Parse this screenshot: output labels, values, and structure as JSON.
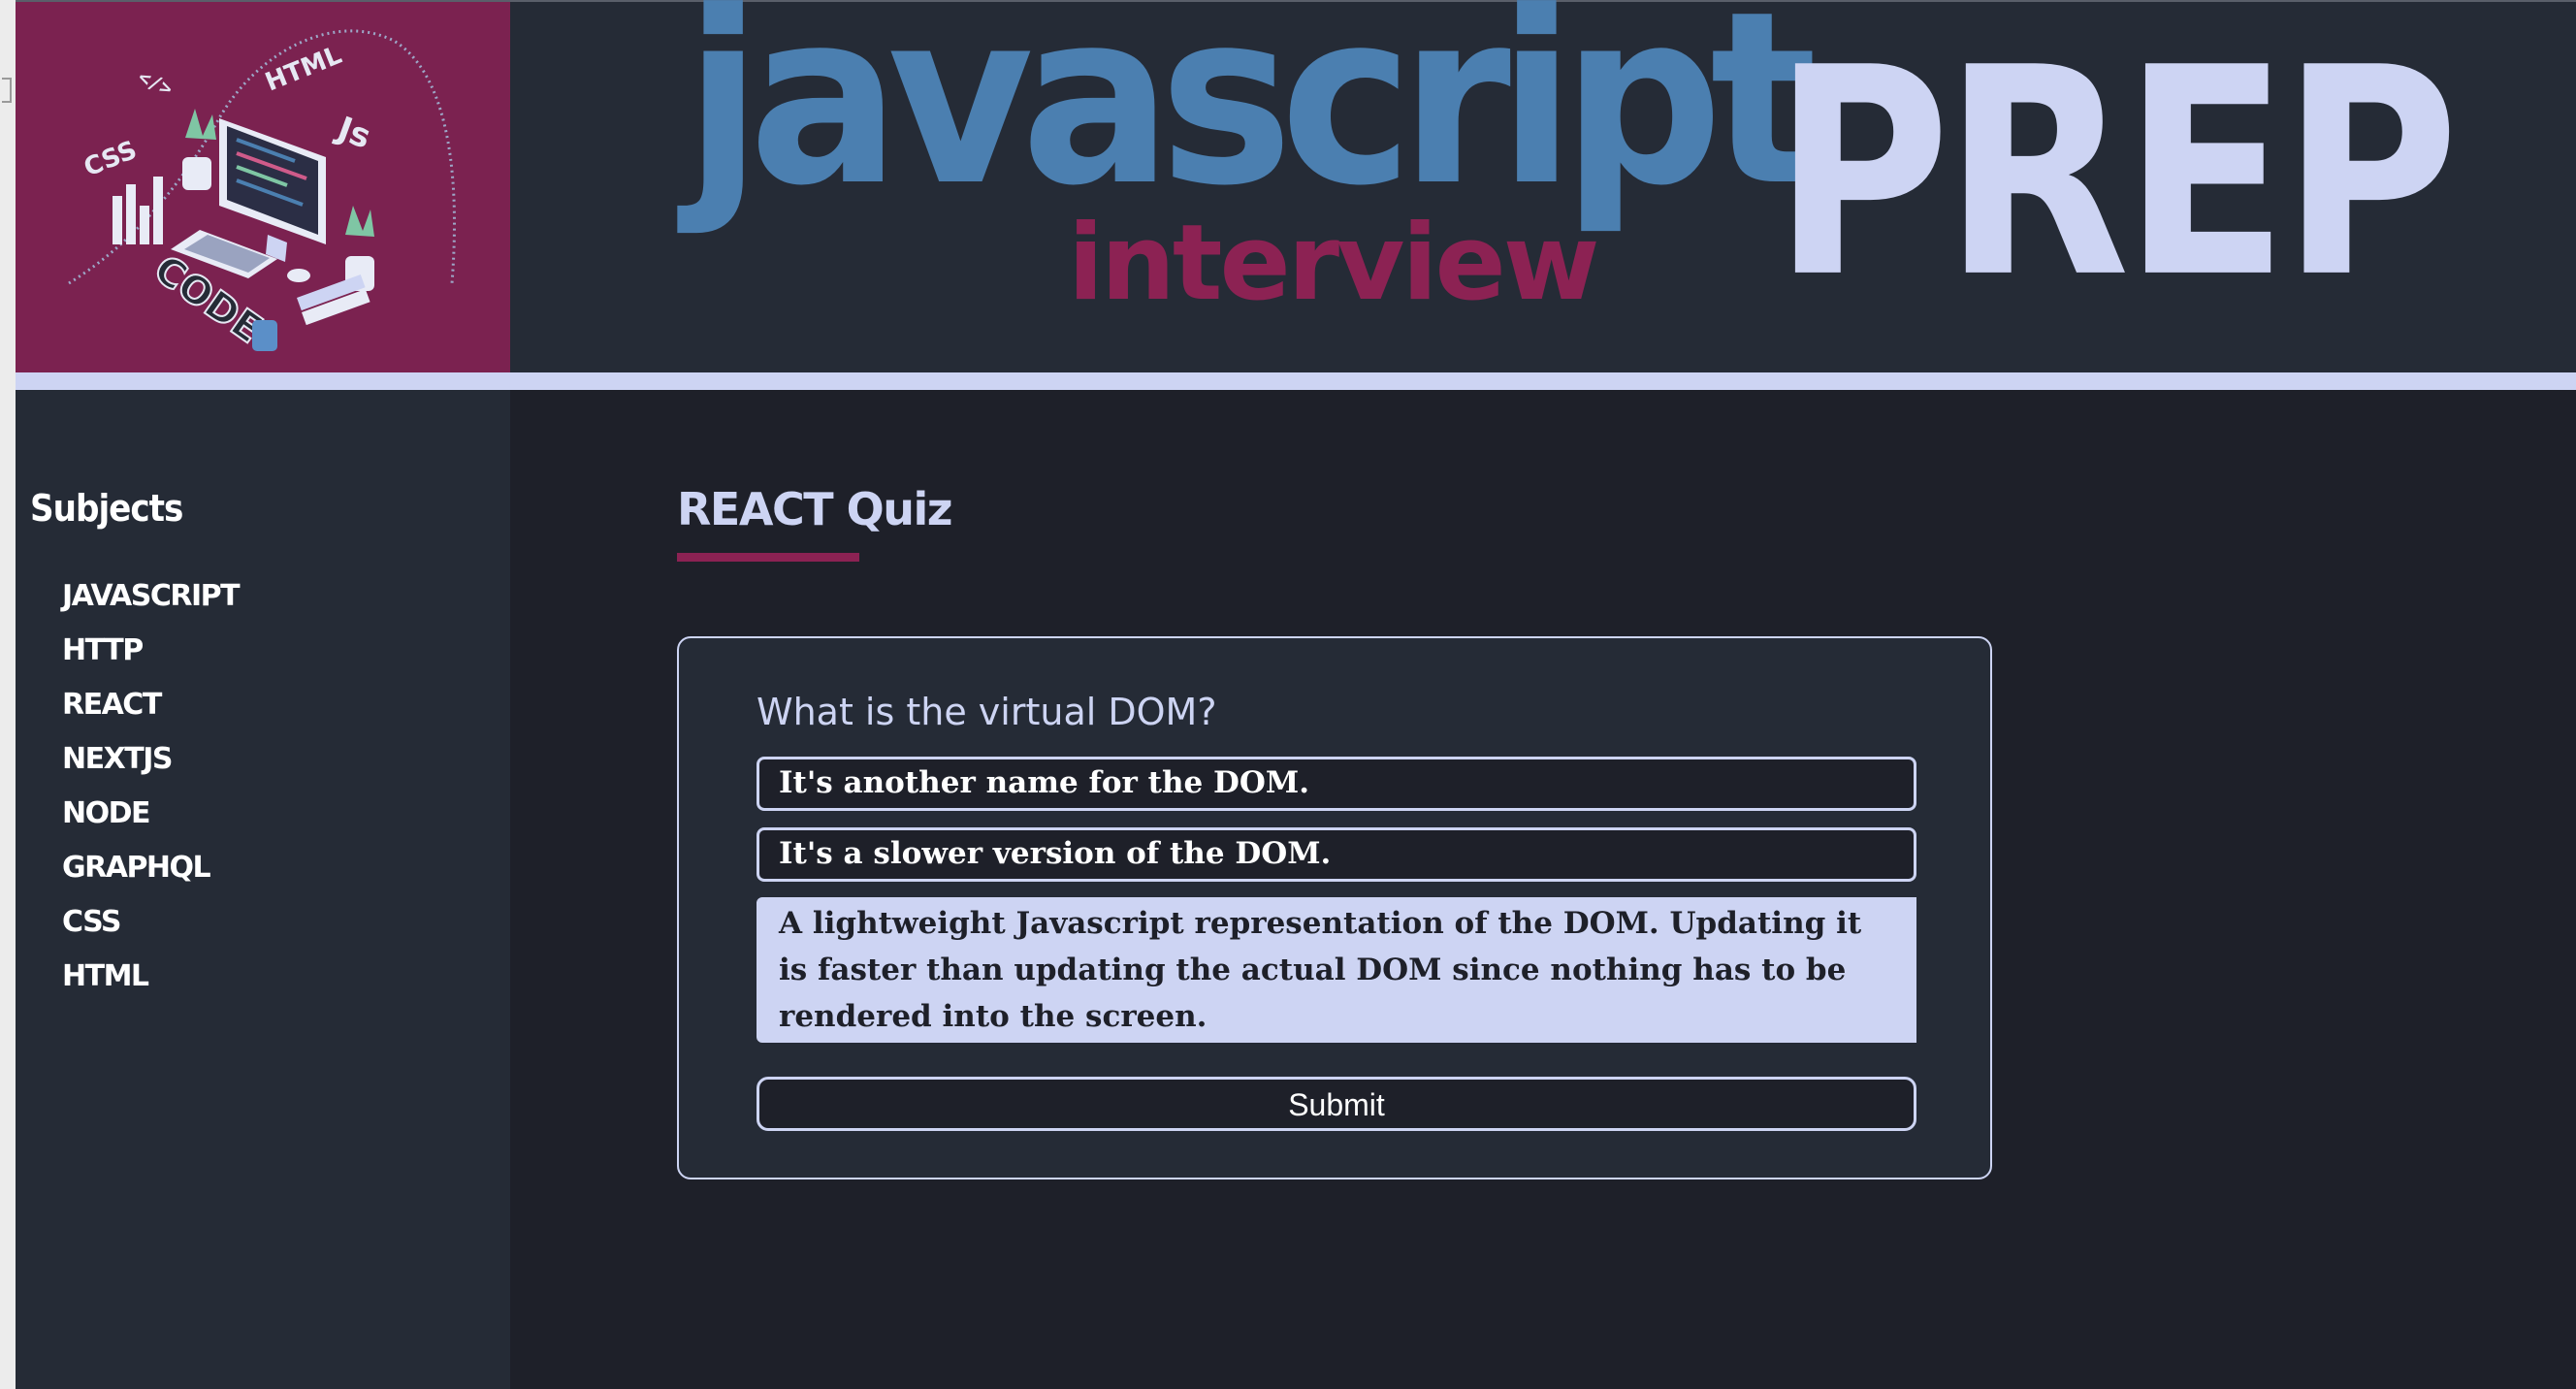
{
  "header": {
    "title_main": "javascript",
    "title_sub": "interview",
    "title_prep": "PREP",
    "logo_labels": [
      "HTML",
      "CSS",
      "Js",
      "</>",
      "CODE"
    ]
  },
  "sidebar": {
    "heading": "Subjects",
    "items": [
      {
        "label": "JAVASCRIPT"
      },
      {
        "label": "HTTP"
      },
      {
        "label": "REACT"
      },
      {
        "label": "NEXTJS"
      },
      {
        "label": "NODE"
      },
      {
        "label": "GRAPHQL"
      },
      {
        "label": "CSS"
      },
      {
        "label": "HTML"
      }
    ]
  },
  "main": {
    "quiz_title": "REACT Quiz",
    "question": "What is the virtual DOM?",
    "answers": [
      {
        "text": "It's another name for the DOM.",
        "selected": false
      },
      {
        "text": "It's a slower version of the DOM.",
        "selected": false
      },
      {
        "text": "A lightweight Javascript representation of the DOM. Updating it is faster than updating the actual DOM since nothing has to be rendered into the screen.",
        "selected": true
      }
    ],
    "submit_label": "Submit"
  },
  "colors": {
    "background": "#1e2029",
    "panel": "#252b36",
    "accent_blue": "#4b7fb0",
    "accent_magenta": "#8c2253",
    "accent_lavender": "#cdd4f3"
  }
}
